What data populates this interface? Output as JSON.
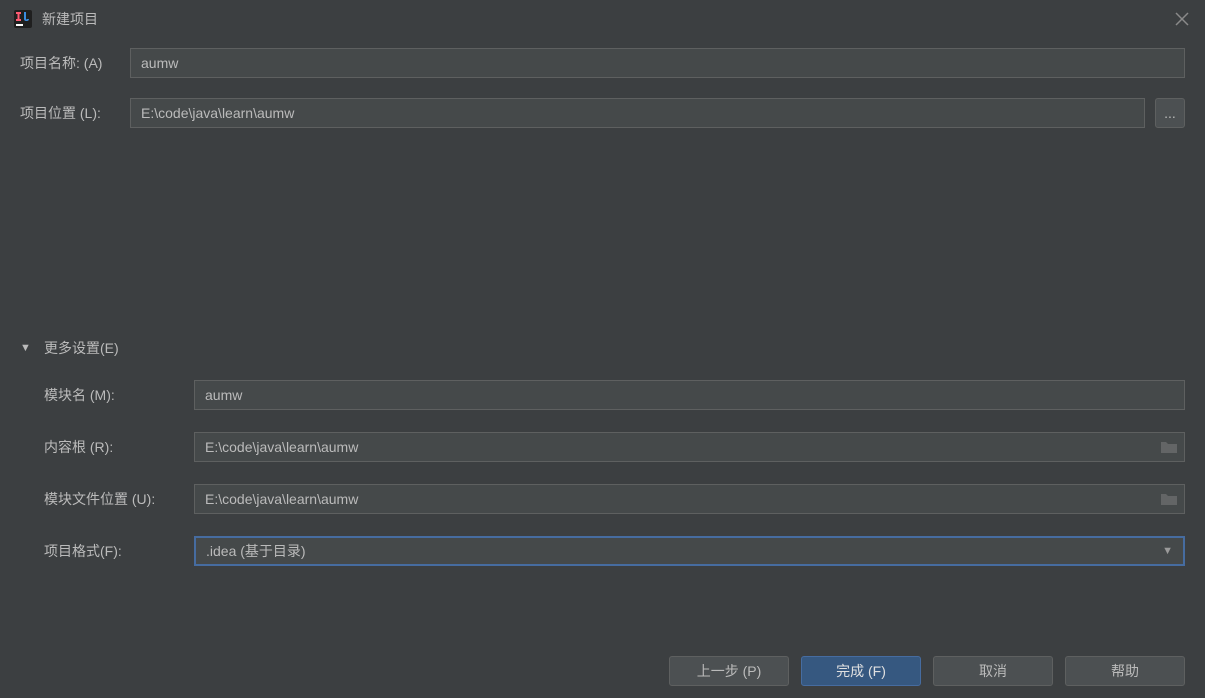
{
  "titlebar": {
    "title": "新建项目"
  },
  "form": {
    "project_name_label": "项目名称: (A)",
    "project_name_value": "aumw",
    "project_location_label": "项目位置 (L):",
    "project_location_value": "E:\\code\\java\\learn\\aumw",
    "browse_text": "..."
  },
  "more_settings": {
    "header_label": "更多设置(E)",
    "module_name_label": "模块名 (M):",
    "module_name_value": "aumw",
    "content_root_label": "内容根 (R):",
    "content_root_value": "E:\\code\\java\\learn\\aumw",
    "module_file_location_label": "模块文件位置 (U):",
    "module_file_location_value": "E:\\code\\java\\learn\\aumw",
    "project_format_label": "项目格式(F):",
    "project_format_value": ".idea (基于目录)"
  },
  "buttons": {
    "previous": "上一步 (P)",
    "finish": "完成 (F)",
    "cancel": "取消",
    "help": "帮助"
  }
}
